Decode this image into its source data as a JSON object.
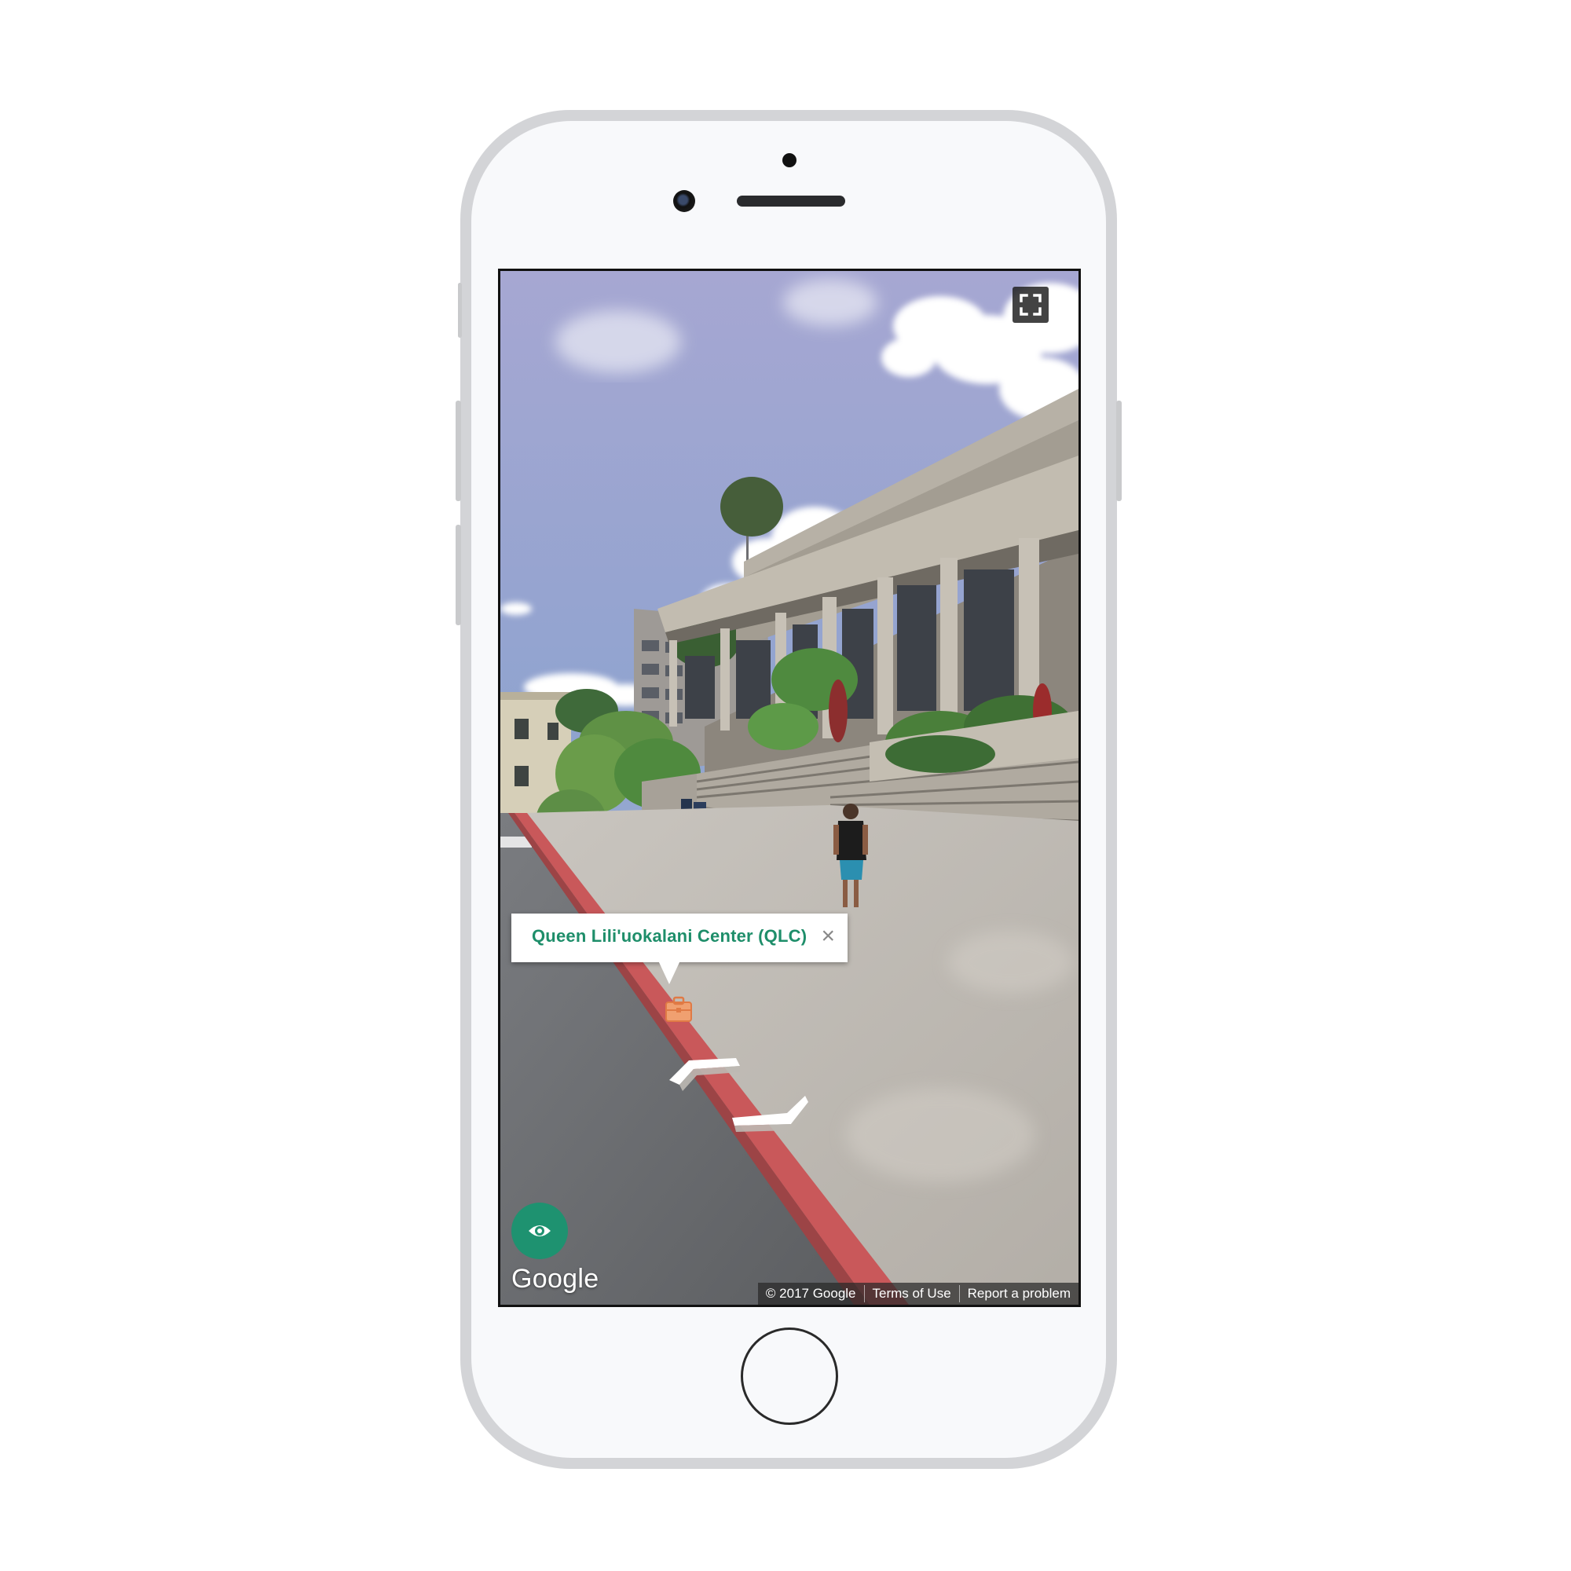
{
  "viewer": {
    "place_title": "Queen Lili'uokalani Center (QLC)",
    "close_symbol": "×",
    "poi_icon": "briefcase-icon",
    "fullscreen_icon": "fullscreen-icon",
    "streetview_icon": "eye-icon",
    "logo": "Google",
    "footer": {
      "copyright": "© 2017 Google",
      "terms": "Terms of Use",
      "report": "Report a problem"
    }
  },
  "colors": {
    "title_green": "#1e8e6a",
    "eye_button": "#1e9270",
    "curb_red": "#c9585a",
    "poi_orange": "#e98c55"
  }
}
